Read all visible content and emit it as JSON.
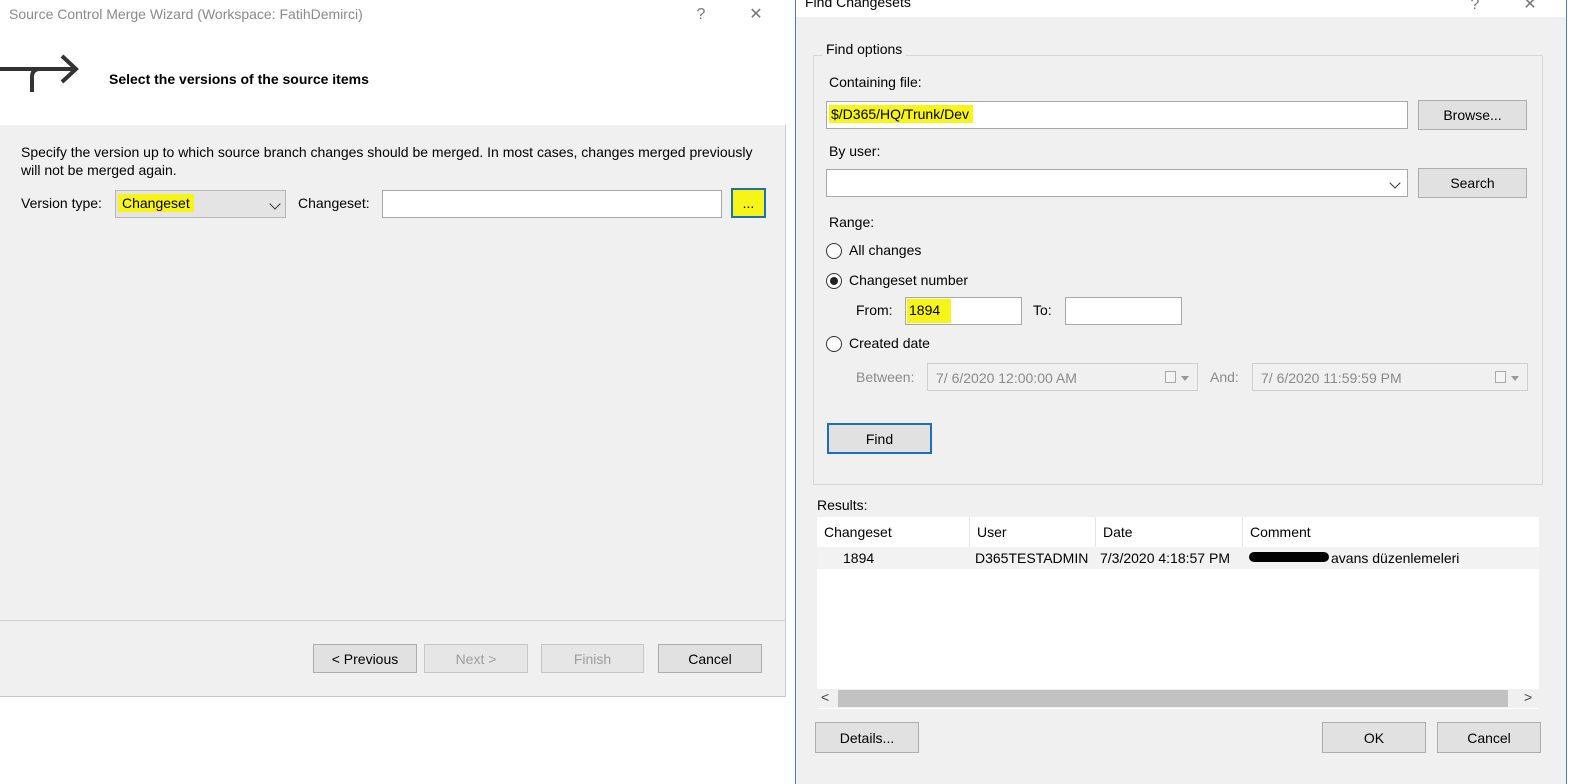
{
  "wizard": {
    "title": "Source Control Merge Wizard (Workspace: FatihDemirci)",
    "help_glyph": "?",
    "close_glyph": "✕",
    "step_title": "Select the versions of the source items",
    "description": "Specify the version up to which source branch changes should be merged.  In most cases, changes merged previously will not be merged again.",
    "version_type_label": "Version type:",
    "version_type_value": "Changeset",
    "changeset_label": "Changeset:",
    "changeset_value": "",
    "ellipsis_label": "...",
    "buttons": {
      "previous": "< Previous",
      "next": "Next >",
      "finish": "Finish",
      "cancel": "Cancel"
    }
  },
  "find": {
    "title": "Find Changesets",
    "help_glyph": "?",
    "close_glyph": "✕",
    "group_label": "Find options",
    "containing_file_label": "Containing file:",
    "containing_file_value": "$/D365/HQ/Trunk/Dev",
    "browse_label": "Browse...",
    "by_user_label": "By user:",
    "by_user_value": "",
    "search_label": "Search",
    "range_label": "Range:",
    "range_options": {
      "all": "All changes",
      "changeset": "Changeset number",
      "date": "Created date"
    },
    "selected_range": "changeset",
    "from_label": "From:",
    "from_value": "1894",
    "to_label": "To:",
    "to_value": "",
    "between_label": "Between:",
    "between_value": "7/  6/2020 12:00:00 AM",
    "and_label": "And:",
    "and_value": "7/  6/2020 11:59:59 PM",
    "find_label": "Find",
    "results_label": "Results:",
    "columns": [
      "Changeset",
      "User",
      "Date",
      "Comment"
    ],
    "rows": [
      {
        "changeset": "1894",
        "user": "D365TESTADMIN",
        "date": "7/3/2020 4:18:57 PM",
        "comment": "avans düzenlemeleri"
      }
    ],
    "details_label": "Details...",
    "ok_label": "OK",
    "cancel_label": "Cancel",
    "scroll_left": "<",
    "scroll_right": ">"
  },
  "colors": {
    "highlight": "#f7f417",
    "focus_border": "#1f6fb7",
    "dialog_bg": "#f0f0f0"
  }
}
